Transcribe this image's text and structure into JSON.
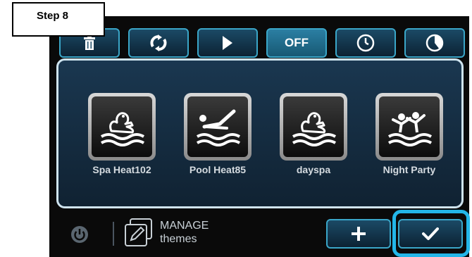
{
  "step_label": "Step 8",
  "toolbar": {
    "buttons": [
      {
        "icon": "trash-icon"
      },
      {
        "icon": "refresh-icon"
      },
      {
        "icon": "play-icon"
      },
      {
        "label": "OFF",
        "active": true
      },
      {
        "icon": "clock-icon"
      },
      {
        "icon": "timer-icon"
      }
    ]
  },
  "themes": [
    {
      "label": "Spa Heat102",
      "icon": "duck-waves-icon"
    },
    {
      "label": "Pool Heat85",
      "icon": "swimmer-lounge-icon"
    },
    {
      "label": "dayspa",
      "icon": "duck-waves-icon"
    },
    {
      "label": "Night Party",
      "icon": "party-people-icon"
    }
  ],
  "bottom": {
    "manage_line1": "MANAGE",
    "manage_line2": "themes",
    "add_icon": "plus-icon",
    "confirm_icon": "checkmark-icon",
    "power_icon": "power-icon"
  },
  "colors": {
    "accent": "#3aa6c8",
    "highlight": "#23b6e8",
    "background": "#0a0a0a"
  }
}
